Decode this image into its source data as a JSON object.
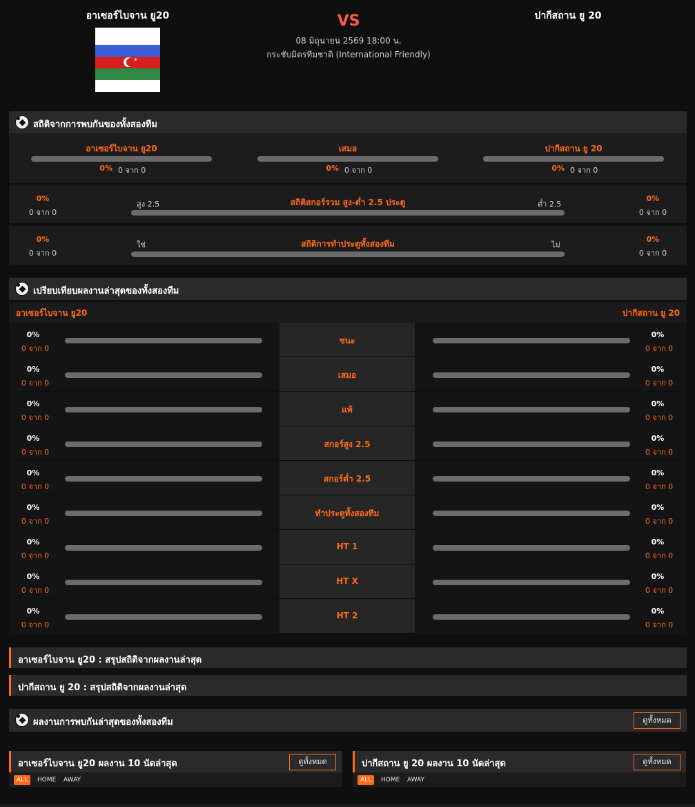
{
  "header": {
    "home_team": "อาเซอร์ไบจาน ยู20",
    "away_team": "ปากีสถาน ยู 20",
    "vs": "VS",
    "date": "08 มิถุนายน 2569 18:00 น.",
    "league": "กระชับมิตรทีมชาติ (International Friendly)"
  },
  "h2h": {
    "title": "สถิติจากการพบกันของทั้งสองทีม",
    "columns": [
      {
        "label": "อาเซอร์ไบจาน ยู20",
        "pct": "0%",
        "count": "0 จาก 0",
        "fill": 0
      },
      {
        "label": "เสมอ",
        "pct": "0%",
        "count": "0 จาก 0",
        "fill": 0
      },
      {
        "label": "ปากีสถาน ยู 20",
        "pct": "0%",
        "count": "0 จาก 0",
        "fill": 0
      }
    ],
    "over_under": {
      "title": "สถิติสกอร์รวม สูง-ต่ำ 2.5 ประตู",
      "left_label": "สูง 2.5",
      "right_label": "ต่ำ 2.5",
      "left_pct": "0%",
      "left_count": "0 จาก 0",
      "right_pct": "0%",
      "right_count": "0 จาก 0"
    },
    "btts": {
      "title": "สถิติการทำประตูทั้งสองทีม",
      "left_label": "ใช่",
      "right_label": "ไม่",
      "left_pct": "0%",
      "left_count": "0 จาก 0",
      "right_pct": "0%",
      "right_count": "0 จาก 0"
    }
  },
  "compare": {
    "title": "เปรียบเทียบผลงานล่าสุดของทั้งสองทีม",
    "home_label": "อาเซอร์ไบจาน ยู20",
    "away_label": "ปากีสถาน ยู 20",
    "rows": [
      {
        "label": "ชนะ",
        "home_pct": "0%",
        "home_count": "0 จาก 0",
        "away_pct": "0%",
        "away_count": "0 จาก 0"
      },
      {
        "label": "เสมอ",
        "home_pct": "0%",
        "home_count": "0 จาก 0",
        "away_pct": "0%",
        "away_count": "0 จาก 0"
      },
      {
        "label": "แพ้",
        "home_pct": "0%",
        "home_count": "0 จาก 0",
        "away_pct": "0%",
        "away_count": "0 จาก 0"
      },
      {
        "label": "สกอร์สูง 2.5",
        "home_pct": "0%",
        "home_count": "0 จาก 0",
        "away_pct": "0%",
        "away_count": "0 จาก 0"
      },
      {
        "label": "สกอร์ต่ำ 2.5",
        "home_pct": "0%",
        "home_count": "0 จาก 0",
        "away_pct": "0%",
        "away_count": "0 จาก 0"
      },
      {
        "label": "ทำประตูทั้งสองทีม",
        "home_pct": "0%",
        "home_count": "0 จาก 0",
        "away_pct": "0%",
        "away_count": "0 จาก 0"
      },
      {
        "label": "HT 1",
        "home_pct": "0%",
        "home_count": "0 จาก 0",
        "away_pct": "0%",
        "away_count": "0 จาก 0"
      },
      {
        "label": "HT X",
        "home_pct": "0%",
        "home_count": "0 จาก 0",
        "away_pct": "0%",
        "away_count": "0 จาก 0"
      },
      {
        "label": "HT 2",
        "home_pct": "0%",
        "home_count": "0 จาก 0",
        "away_pct": "0%",
        "away_count": "0 จาก 0"
      }
    ]
  },
  "summaries": {
    "home": "อาเซอร์ไบจาน ยู20 : สรุปสถิติจากผลงานล่าสุด",
    "away": "ปากีสถาน ยู 20 : สรุปสถิติจากผลงานล่าสุด"
  },
  "recent_h2h": {
    "title": "ผลงานการพบกันล่าสุดของทั้งสองทีม",
    "view_all": "ดูทั้งหมด"
  },
  "recent_home": {
    "title": "อาเซอร์ไบจาน ยู20 ผลงาน 10 นัดล่าสุด",
    "view_all": "ดูทั้งหมด",
    "tabs": [
      "ALL",
      "HOME",
      "AWAY"
    ]
  },
  "recent_away": {
    "title": "ปากีสถาน ยู 20 ผลงาน 10 นัดล่าสุด",
    "view_all": "ดูทั้งหมด",
    "tabs": [
      "ALL",
      "HOME",
      "AWAY"
    ]
  },
  "colors": {
    "accent": "#ff6a1a",
    "vs": "#ff5a4b",
    "bar_track": "#6b6b6b",
    "background": "#0f0f0f"
  },
  "icons": {
    "section": "soccer-ball-icon",
    "flag": "azerbaijan-flag"
  }
}
